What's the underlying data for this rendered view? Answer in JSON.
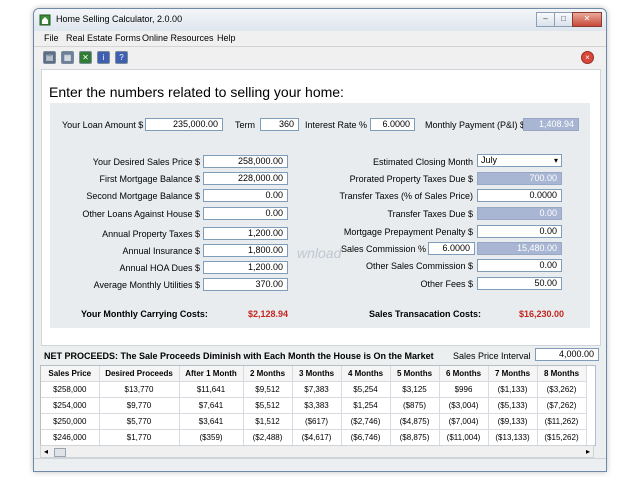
{
  "window": {
    "title": "Home Selling Calculator, 2.0.00",
    "controls": {
      "minimize": "–",
      "maximize": "□",
      "close": "✕"
    }
  },
  "menu": [
    "File",
    "Real Estate Forms",
    "Online Resources",
    "Help"
  ],
  "toolbar": {
    "buttons": [
      {
        "name": "print-icon",
        "color": "#5a6e85"
      },
      {
        "name": "document-icon",
        "color": "#6c8099"
      },
      {
        "name": "excel-icon",
        "color": "#2e7d32"
      },
      {
        "name": "info-icon",
        "color": "#3f5fb0"
      },
      {
        "name": "help-icon",
        "color": "#3f5fb0"
      }
    ],
    "close_symbol": "×"
  },
  "heading": "Enter the numbers related to selling your home:",
  "loan": {
    "amount_label": "Your Loan Amount $",
    "amount_value": "235,000.00",
    "term_label": "Term",
    "term_value": "360",
    "rate_label": "Interest Rate %",
    "rate_value": "6.0000",
    "payment_label": "Monthly Payment (P&I) $",
    "payment_value": "1,408.94"
  },
  "left_fields": [
    {
      "label": "Your Desired Sales Price $",
      "value": "258,000.00"
    },
    {
      "label": "First Mortgage Balance $",
      "value": "228,000.00"
    },
    {
      "label": "Second Mortgage Balance $",
      "value": "0.00"
    },
    {
      "label": "Other Loans Against House $",
      "value": "0.00"
    },
    {
      "label": "Annual Property Taxes $",
      "value": "1,200.00"
    },
    {
      "label": "Annual Insurance $",
      "value": "1,800.00"
    },
    {
      "label": "Annual HOA Dues $",
      "value": "1,200.00"
    },
    {
      "label": "Average Monthly Utilities $",
      "value": "370.00"
    }
  ],
  "right_fields": {
    "closing_month_label": "Estimated Closing Month",
    "closing_month_value": "July",
    "prorated_label": "Prorated Property Taxes Due $",
    "prorated_value": "700.00",
    "transfer_pct_label": "Transfer Taxes (% of Sales Price)",
    "transfer_pct_value": "0.0000",
    "transfer_due_label": "Transfer Taxes Due $",
    "transfer_due_value": "0.00",
    "prepay_label": "Mortgage Prepayment Penalty $",
    "prepay_value": "0.00",
    "commission_label": "Sales Commission %",
    "commission_pct": "6.0000",
    "commission_value": "15,480.00",
    "other_comm_label": "Other Sales Commission $",
    "other_comm_value": "0.00",
    "other_fees_label": "Other Fees $",
    "other_fees_value": "50.00"
  },
  "totals": {
    "carrying_label": "Your Monthly Carrying Costs:",
    "carrying_value": "$2,128.94",
    "transaction_label": "Sales Transacation Costs:",
    "transaction_value": "$16,230.00"
  },
  "watermark": "wnload",
  "net": {
    "title": "NET PROCEEDS:  The Sale Proceeds Diminish with Each Month the House is On the Market",
    "interval_label": "Sales Price Interval",
    "interval_value": "4,000.00",
    "columns": [
      "Sales Price",
      "Desired Proceeds",
      "After 1 Month",
      "2 Months",
      "3 Months",
      "4 Months",
      "5 Months",
      "6 Months",
      "7 Months",
      "8 Months"
    ],
    "rows": [
      [
        "$258,000",
        "$13,770",
        "$11,641",
        "$9,512",
        "$7,383",
        "$5,254",
        "$3,125",
        "$996",
        "($1,133)",
        "($3,262)"
      ],
      [
        "$254,000",
        "$9,770",
        "$7,641",
        "$5,512",
        "$3,383",
        "$1,254",
        "($875)",
        "($3,004)",
        "($5,133)",
        "($7,262)"
      ],
      [
        "$250,000",
        "$5,770",
        "$3,641",
        "$1,512",
        "($617)",
        "($2,746)",
        "($4,875)",
        "($7,004)",
        "($9,133)",
        "($11,262)"
      ],
      [
        "$246,000",
        "$1,770",
        "($359)",
        "($2,488)",
        "($4,617)",
        "($6,746)",
        "($8,875)",
        "($11,004)",
        "($13,133)",
        "($15,262)"
      ]
    ]
  }
}
